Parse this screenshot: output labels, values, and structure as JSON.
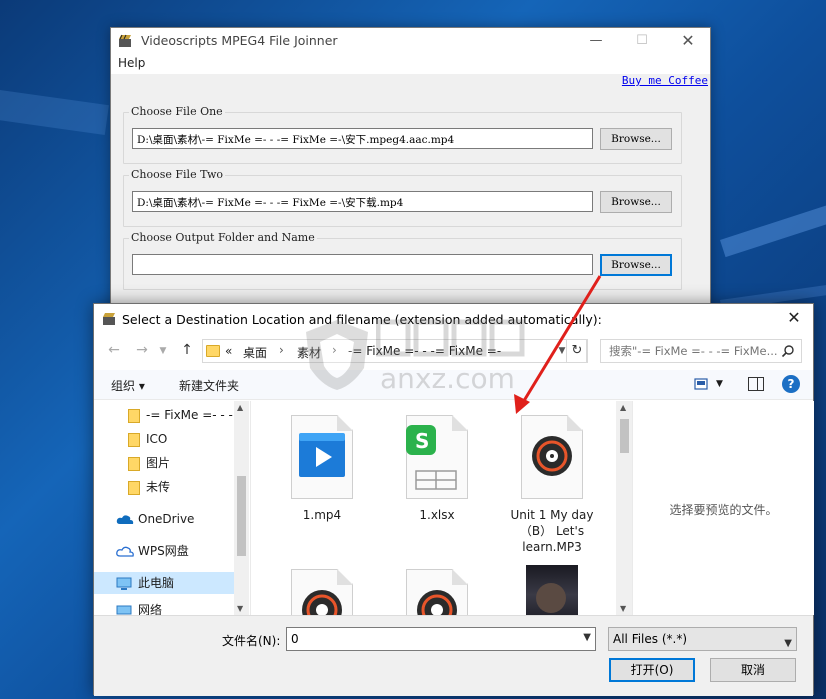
{
  "joiner": {
    "title": "Videoscripts MPEG4 File Joinner",
    "menu_help": "Help",
    "buy_link": "Buy me Coffee",
    "file_one": {
      "legend": "Choose File One",
      "value": "D:\\桌面\\素材\\-= FixMe =- - -= FixMe =-\\安下.mpeg4.aac.mp4",
      "browse": "Browse..."
    },
    "file_two": {
      "legend": "Choose File Two",
      "value": "D:\\桌面\\素材\\-= FixMe =- - -= FixMe =-\\安下载.mp4",
      "browse": "Browse..."
    },
    "output": {
      "legend": "Choose Output Folder and Name",
      "value": "",
      "browse": "Browse..."
    }
  },
  "dialog": {
    "title": "Select a Destination Location and filename (extension added automatically):",
    "breadcrumb": [
      "«",
      "桌面",
      "›",
      "素材",
      "›",
      "-= FixMe =- - -= FixMe =-"
    ],
    "search_placeholder": "搜索\"-= FixMe =- - -= FixMe...",
    "toolbar": {
      "organize": "组织 ▾",
      "new_folder": "新建文件夹"
    },
    "nav_items": [
      {
        "label": "-= FixMe =- - -",
        "icon": "folder-icon"
      },
      {
        "label": "ICO",
        "icon": "folder-icon"
      },
      {
        "label": "图片",
        "icon": "folder-icon"
      },
      {
        "label": "未传",
        "icon": "folder-icon"
      },
      {
        "label": "OneDrive",
        "icon": "cloud-icon"
      },
      {
        "label": "WPS网盘",
        "icon": "cloud-outline-icon"
      },
      {
        "label": "此电脑",
        "icon": "computer-icon"
      },
      {
        "label": "网络",
        "icon": "network-icon"
      }
    ],
    "files": [
      {
        "name": "1.mp4",
        "icon": "video-file-icon"
      },
      {
        "name": "1.xlsx",
        "icon": "spreadsheet-file-icon"
      },
      {
        "name": "Unit 1 My day (B) Let's learn.MP3",
        "line1": "Unit 1 My day",
        "line2": "（B） Let's",
        "line3": "learn.MP3",
        "icon": "audio-file-icon"
      }
    ],
    "preview_text": "选择要预览的文件。",
    "filename_label": "文件名(N):",
    "filename_value": "0",
    "filetype": "All Files (*.*)",
    "open_button": "打开(O)",
    "cancel_button": "取消"
  },
  "watermark": {
    "text": "anxz.com"
  },
  "colors": {
    "accent": "#0078d7",
    "arrow": "#e0201b",
    "selected": "#cce8ff"
  }
}
